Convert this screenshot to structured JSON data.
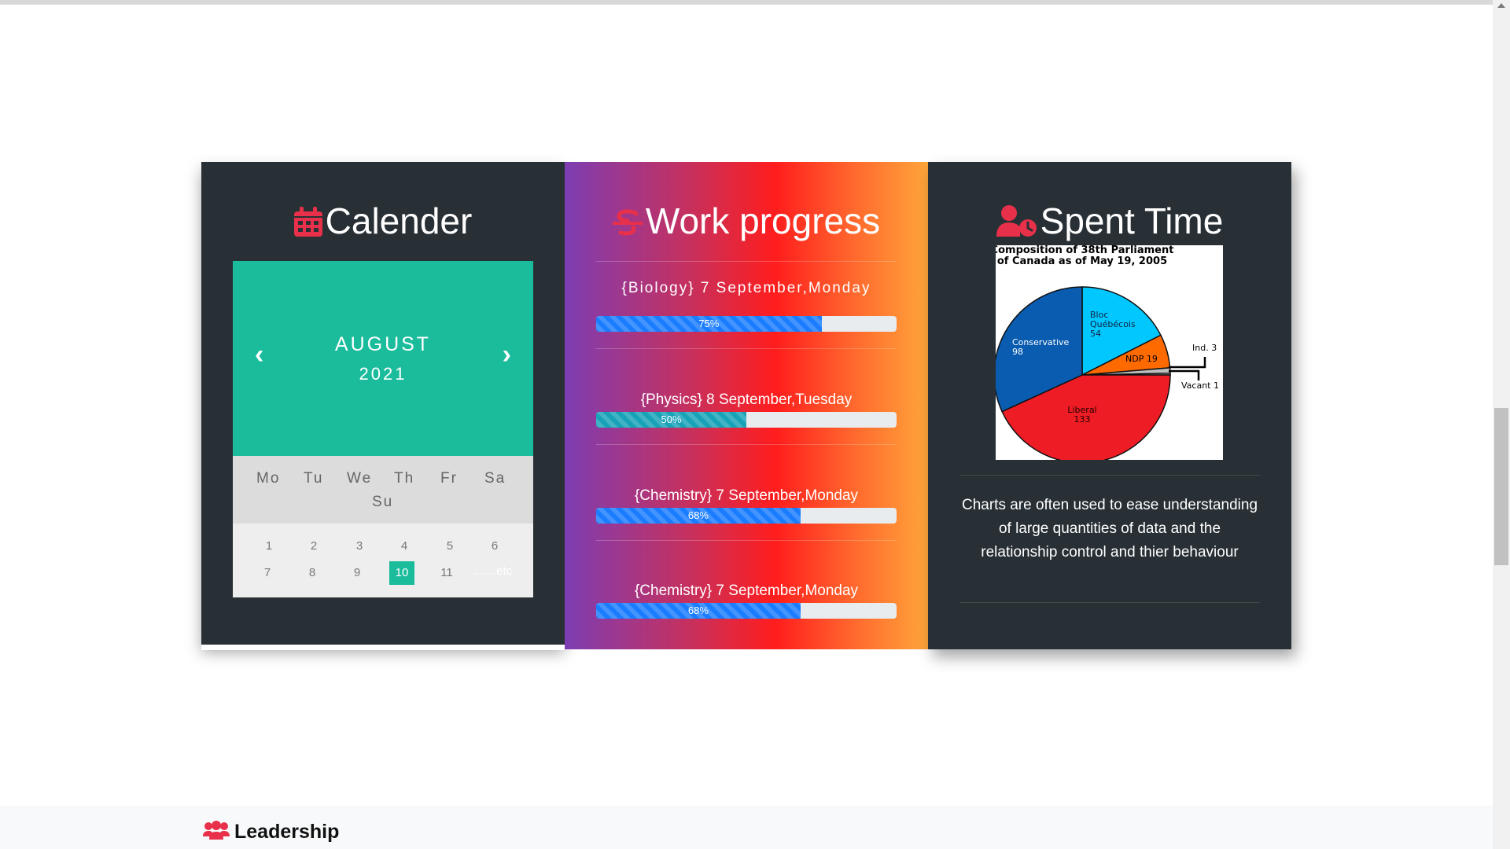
{
  "calendar": {
    "title": "Calender",
    "month": "AUGUST",
    "year": "2021",
    "weekdays": [
      "Mo",
      "Tu",
      "We",
      "Th",
      "Fr",
      "Sa",
      "Su"
    ],
    "days": [
      "1",
      "2",
      "3",
      "4",
      "5",
      "6",
      "7",
      "8",
      "9",
      "10",
      "11"
    ],
    "selected_day": "10",
    "etc": ".......etc",
    "prev_glyph": "‹",
    "next_glyph": "›",
    "accent": "#1abc9c"
  },
  "progress": {
    "title": "Work progress",
    "items": [
      {
        "label": "{Biology} 7 September,Monday",
        "percent": 75,
        "percent_text": "75%",
        "color": "#1a7cff"
      },
      {
        "label": "{Physics} 8 September,Tuesday",
        "percent": 50,
        "percent_text": "50%",
        "color": "#17a2b8"
      },
      {
        "label": "{Chemistry} 7 September,Monday",
        "percent": 68,
        "percent_text": "68%",
        "color": "#1a7cff"
      },
      {
        "label": "{Chemistry} 7 September,Monday",
        "percent": 68,
        "percent_text": "68%",
        "color": "#1a7cff"
      }
    ]
  },
  "spent": {
    "title": "Spent Time",
    "description": "Charts are often used to ease understanding of large quantities of data and the relationship control and thier behaviour"
  },
  "chart_data": {
    "type": "pie",
    "title": "Composition of 38th Parliament of Canada as of May 19, 2005",
    "slices": [
      {
        "name": "Bloc Québécois",
        "value": 54,
        "color": "#00c8ff"
      },
      {
        "name": "NDP",
        "value": 19,
        "color": "#ff6a00"
      },
      {
        "name": "Ind.",
        "value": 3,
        "color": "#c0c0c0"
      },
      {
        "name": "Vacant",
        "value": 1,
        "color": "#ffffff"
      },
      {
        "name": "Liberal",
        "value": 133,
        "color": "#ee1c25"
      },
      {
        "name": "Conservative",
        "value": 98,
        "color": "#0a5cb0"
      }
    ],
    "labels": {
      "bloc": [
        "Bloc",
        "Québécois",
        "54"
      ],
      "ndp": "NDP 19",
      "ind": "Ind. 3",
      "vacant": "Vacant 1",
      "liberal": [
        "Liberal",
        "133"
      ],
      "conservative": [
        "Conservative",
        "98"
      ],
      "title_lines": [
        "Composition of 38th Parliament",
        "of Canada as of May 19, 2005"
      ]
    }
  },
  "leadership": {
    "title": "Leadership"
  },
  "colors": {
    "panel_dark": "#283035",
    "icon_red": "#e8304a"
  }
}
